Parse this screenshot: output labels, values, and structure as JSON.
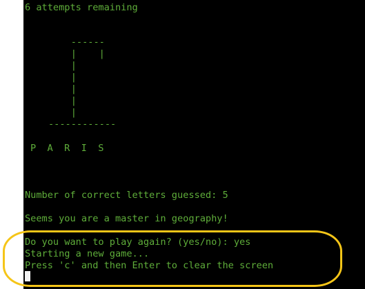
{
  "terminal": {
    "attempts": "6 attempts remaining",
    "gallows": [
      "    ------",
      "    |    |",
      "    |",
      "    |",
      "    |",
      "    |",
      "    |",
      "------------"
    ],
    "word": "P  A  R  I  S",
    "correct_count": "Number of correct letters guessed: 5",
    "message": "Seems you are a master in geography!",
    "prompt": "Do you want to play again? (yes/no): yes",
    "status": "Starting a new game...",
    "hint": "Press 'c' and then Enter to clear the screen"
  },
  "colors": {
    "text": "#5fae3a",
    "background": "#000000",
    "highlight": "#f5c518"
  }
}
